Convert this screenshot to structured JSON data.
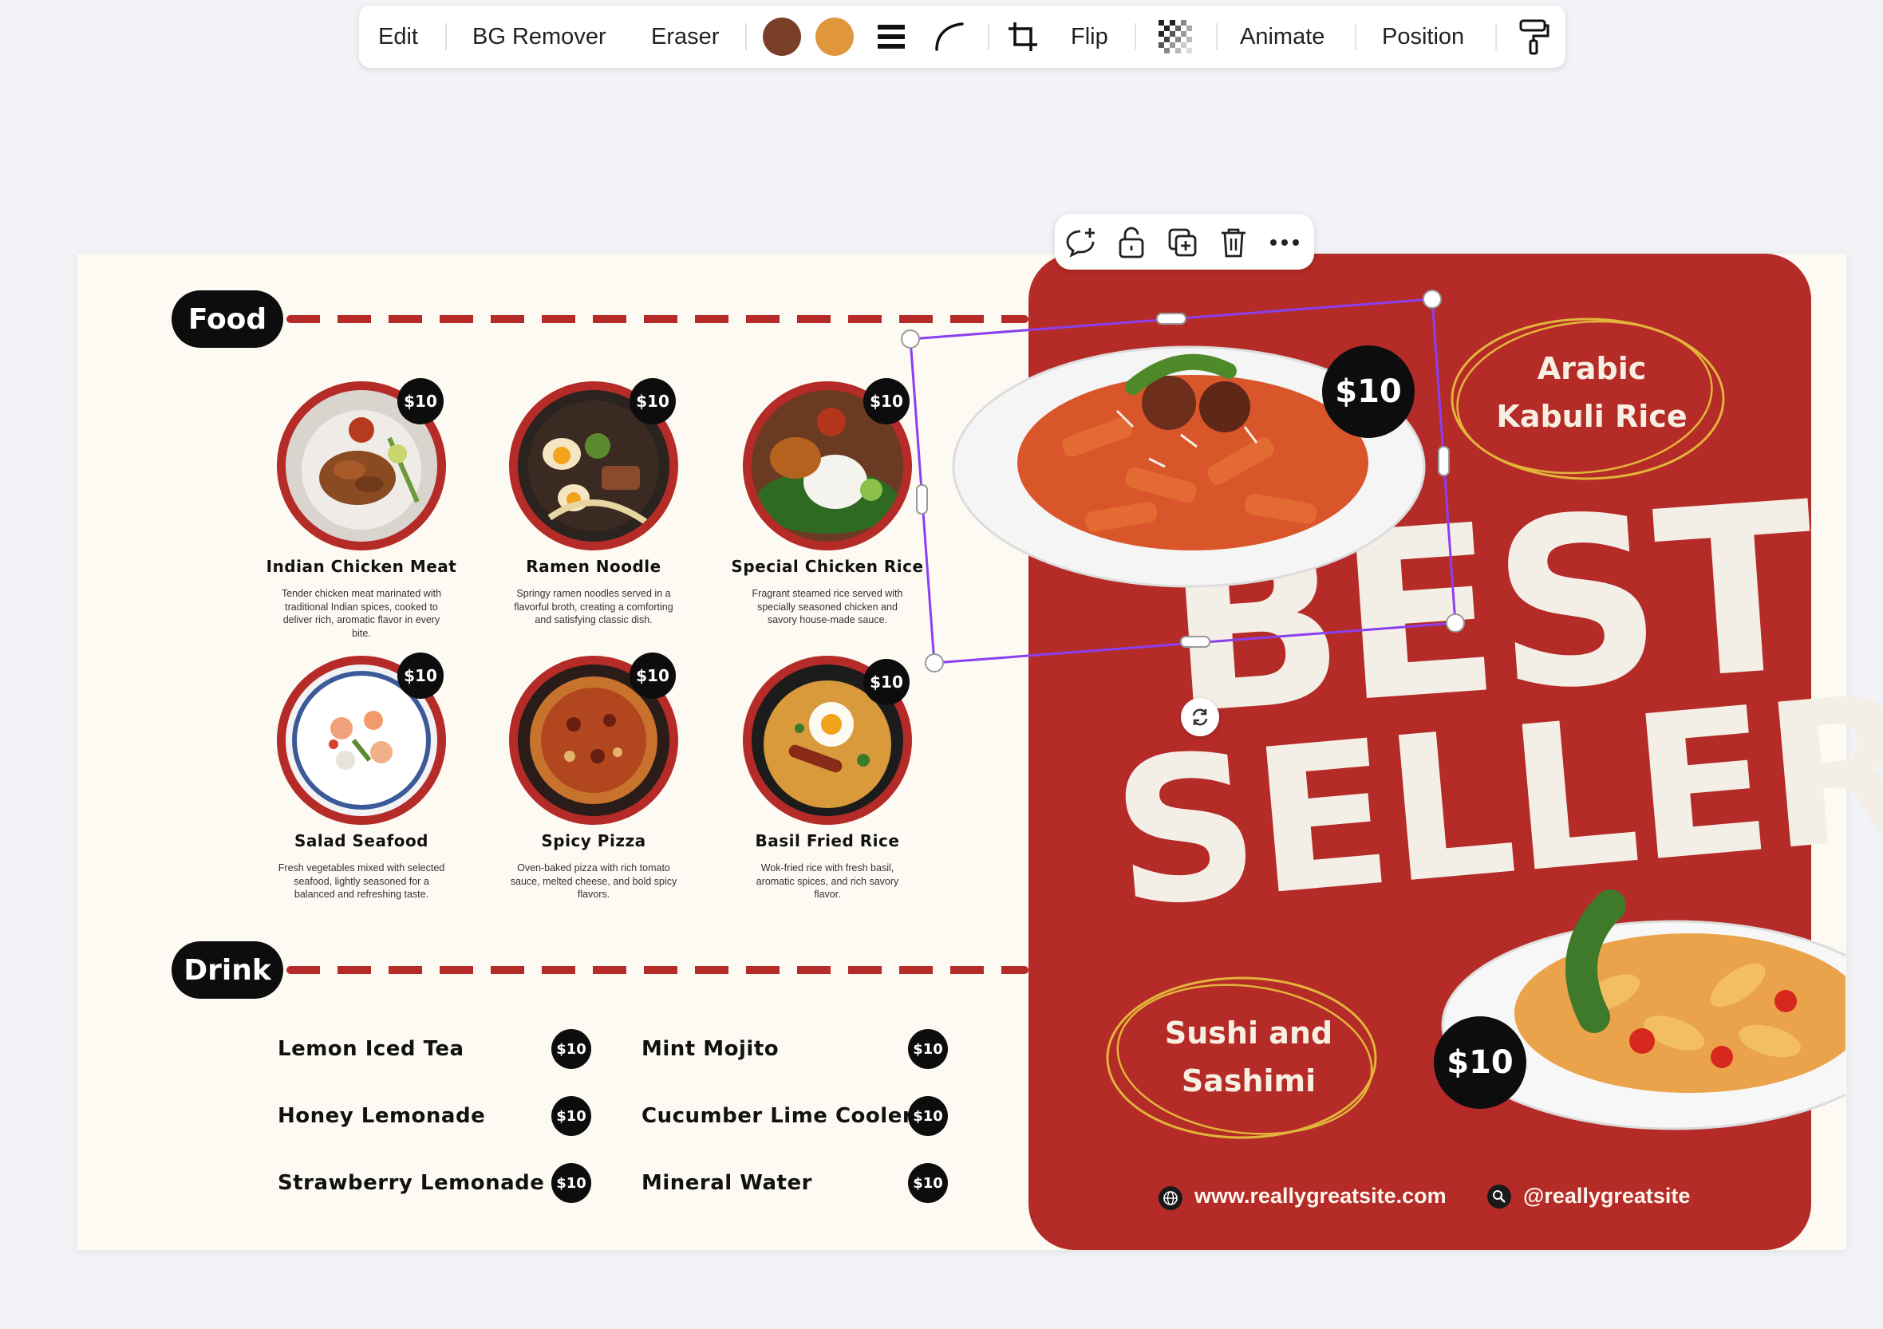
{
  "toolbar": {
    "edit": "Edit",
    "bg_remover": "BG Remover",
    "eraser": "Eraser",
    "color_1": "#7a3f28",
    "color_2": "#e0963d",
    "flip": "Flip",
    "animate": "Animate",
    "position": "Position",
    "icons": [
      "lines-icon",
      "corner-rounding-icon",
      "crop-icon",
      "transparency-icon",
      "paint-roller-icon"
    ]
  },
  "element_toolbar": {
    "icons": [
      "comment-add-icon",
      "lock-icon",
      "duplicate-icon",
      "trash-icon",
      "more-icon"
    ]
  },
  "menu": {
    "food_section": "Food",
    "drink_section": "Drink",
    "foods": [
      {
        "name": "Indian Chicken Meat",
        "price": "$10",
        "description": "Tender chicken meat marinated with traditional Indian spices, cooked to deliver rich, aromatic flavor in every bite."
      },
      {
        "name": "Ramen Noodle",
        "price": "$10",
        "description": "Springy ramen noodles served in a flavorful broth, creating a comforting and satisfying classic dish."
      },
      {
        "name": "Special Chicken Rice",
        "price": "$10",
        "description": "Fragrant steamed rice served with specially seasoned chicken and savory house-made sauce."
      },
      {
        "name": "Salad Seafood",
        "price": "$10",
        "description": "Fresh vegetables mixed with selected seafood, lightly seasoned for a balanced and refreshing taste."
      },
      {
        "name": "Spicy Pizza",
        "price": "$10",
        "description": "Oven-baked pizza with rich tomato sauce, melted cheese, and bold spicy flavors."
      },
      {
        "name": "Basil Fried Rice",
        "price": "$10",
        "description": "Wok-fried rice with fresh basil, aromatic spices, and rich savory flavor."
      }
    ],
    "drinks": [
      {
        "name": "Lemon Iced Tea",
        "price": "$10"
      },
      {
        "name": "Honey Lemonade",
        "price": "$10"
      },
      {
        "name": "Strawberry Lemonade",
        "price": "$10"
      },
      {
        "name": "Mint Mojito",
        "price": "$10"
      },
      {
        "name": "Cucumber Lime Cooler",
        "price": "$10"
      },
      {
        "name": "Mineral Water",
        "price": "$10"
      }
    ]
  },
  "panel": {
    "best": "BEST",
    "seller": "SELLER",
    "top_price": "$10",
    "bottom_price": "$10",
    "arabic_line1": "Arabic",
    "arabic_line2": "Kabuli Rice",
    "sushi_line1": "Sushi and",
    "sushi_line2": "Sashimi",
    "website": "www.reallygreatsite.com",
    "handle": "@reallygreatsite",
    "colors": {
      "panel_red": "#b52b27",
      "cream": "#f3eee6",
      "selection": "#8b3ff0",
      "circle_gold": "#e2b43a"
    }
  }
}
